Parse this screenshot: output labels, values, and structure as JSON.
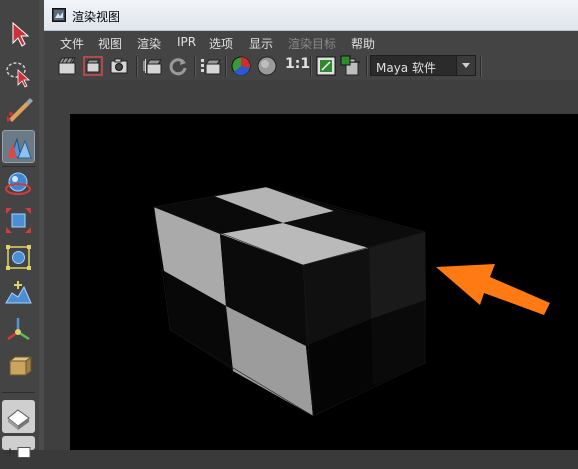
{
  "window": {
    "title": "渲染视图"
  },
  "menu": {
    "items": [
      {
        "label": "文件",
        "enabled": true
      },
      {
        "label": "视图",
        "enabled": true
      },
      {
        "label": "渲染",
        "enabled": true
      },
      {
        "label": "IPR",
        "enabled": true
      },
      {
        "label": "选项",
        "enabled": true
      },
      {
        "label": "显示",
        "enabled": true
      },
      {
        "label": "渲染目标",
        "enabled": false
      },
      {
        "label": "帮助",
        "enabled": true
      }
    ]
  },
  "toolbar": {
    "ratio_label": "1:1",
    "renderer": {
      "selected": "Maya 软件"
    },
    "icons": [
      "redo-render-icon",
      "render-region-icon",
      "snapshot-icon",
      "ipr-render-icon",
      "refresh-icon",
      "render-sequence-icon",
      "rgb-channels-icon",
      "alpha-channel-icon",
      "real-size-icon",
      "keep-image-icon",
      "remove-image-icon"
    ]
  },
  "left_toolbar": {
    "tools": [
      "select-tool-icon",
      "lasso-select-icon",
      "paint-select-icon",
      "move-tool-icon",
      "rotate-tool-icon",
      "scale-tool-icon",
      "universal-manipulator-icon",
      "soft-modification-icon",
      "show-manipulator-icon",
      "last-tool-icon"
    ],
    "active_tool": "move-tool-icon"
  },
  "colors": {
    "arrow_annotation": "#ff7a12",
    "checker_light": "#b4b4b4",
    "checker_dark": "#0a0a0a",
    "render_background": "#000000"
  }
}
